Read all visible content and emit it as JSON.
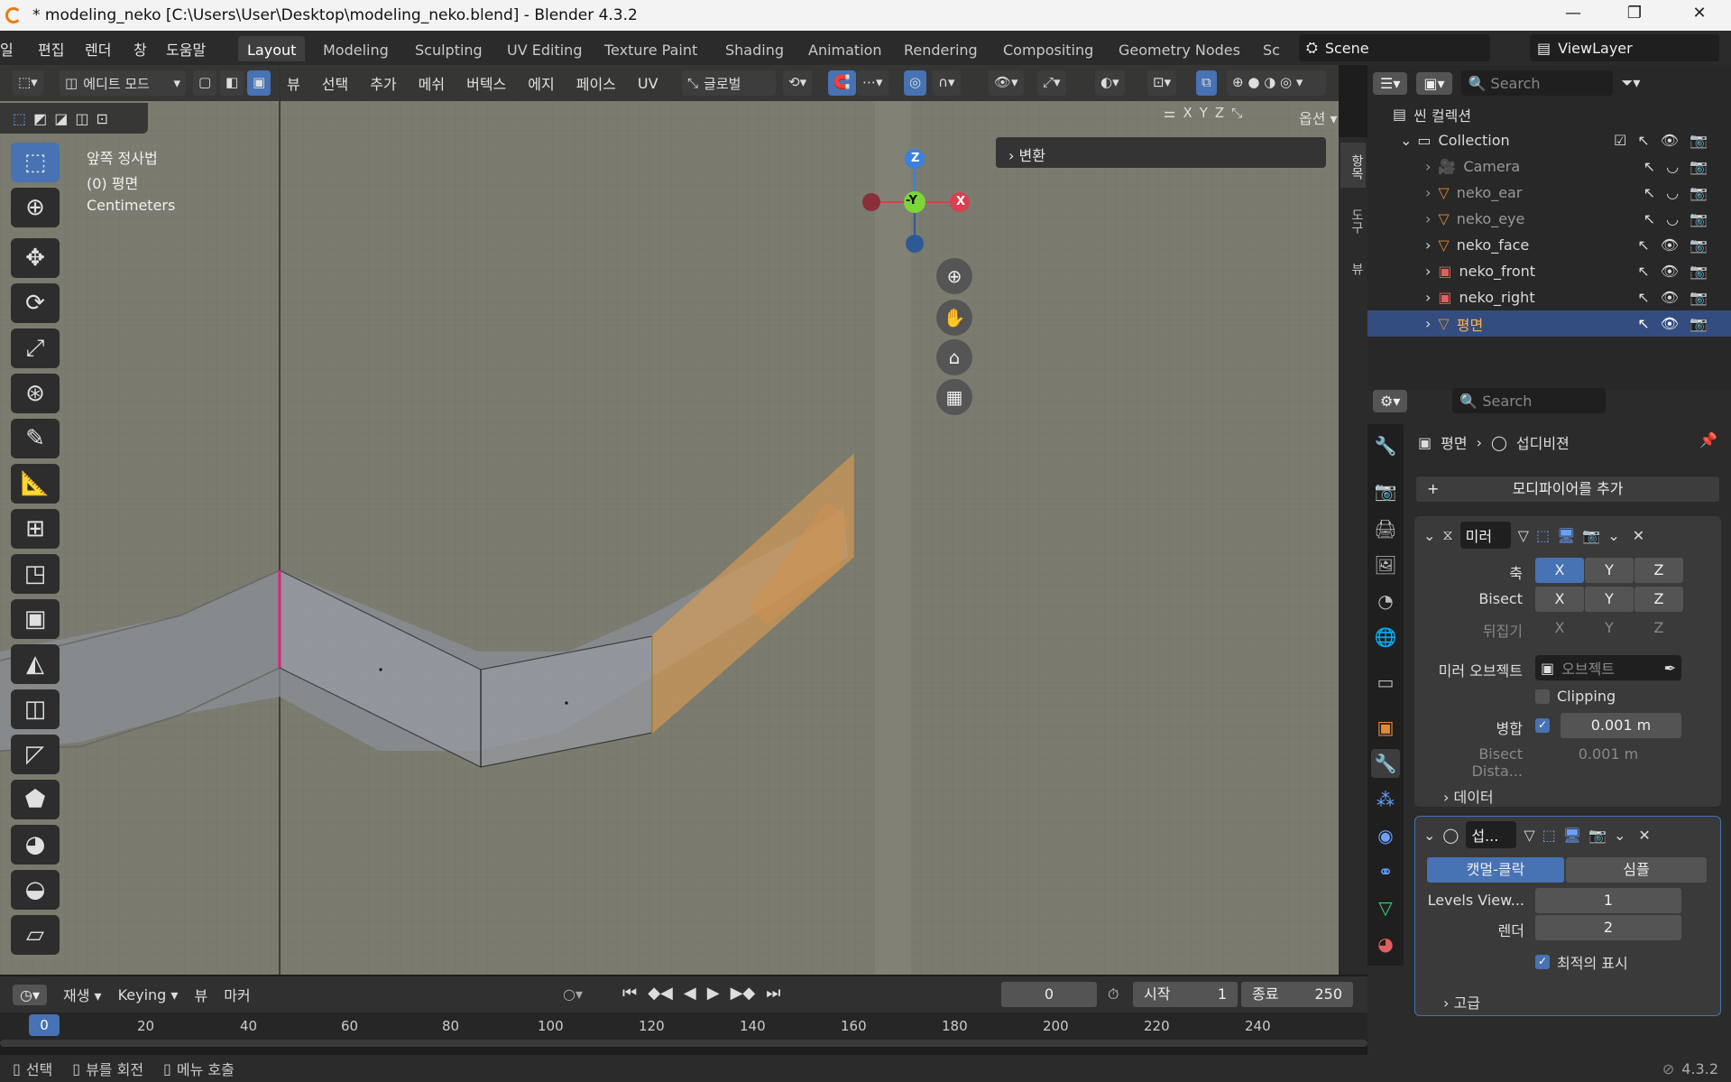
{
  "titlebar": {
    "title": "* modeling_neko [C:\\Users\\User\\Desktop\\modeling_neko.blend] - Blender 4.3.2",
    "minimize": "—",
    "restore": "❐",
    "close": "✕"
  },
  "menu": {
    "file": "일",
    "edit": "편집",
    "render": "렌더",
    "window": "창",
    "help": "도움말"
  },
  "workspaces": [
    "Layout",
    "Modeling",
    "Sculpting",
    "UV Editing",
    "Texture Paint",
    "Shading",
    "Animation",
    "Rendering",
    "Compositing",
    "Geometry Nodes",
    "Sc"
  ],
  "scene": {
    "name": "Scene",
    "viewlayer": "ViewLayer"
  },
  "vheader": {
    "mode": "에디트 모드",
    "menus": [
      "뷰",
      "선택",
      "추가",
      "메쉬",
      "버텍스",
      "에지",
      "페이스",
      "UV"
    ],
    "orientation": "글로벌",
    "options": "옵션",
    "axes": [
      "X",
      "Y",
      "Z"
    ]
  },
  "viewport": {
    "view_name": "앞쪽 정사법",
    "object_label": "(0) 평면",
    "units": "Centimeters",
    "panel_title": "변환",
    "side_tabs": [
      "항목",
      "도구",
      "뷰"
    ],
    "gizmo": {
      "z": "Z",
      "y": "-Y",
      "x": "X"
    }
  },
  "outliner": {
    "search_placeholder": "Search",
    "root": "씬 컬렉션",
    "collection": "Collection",
    "items": [
      {
        "name": "Camera"
      },
      {
        "name": "neko_ear"
      },
      {
        "name": "neko_eye"
      },
      {
        "name": "neko_face"
      },
      {
        "name": "neko_front"
      },
      {
        "name": "neko_right"
      },
      {
        "name": "평면"
      }
    ]
  },
  "properties": {
    "search_placeholder": "Search",
    "breadcrumb_object": "평면",
    "breadcrumb_modifier": "섭디비젼",
    "add_modifier": "모디파이어를 추가",
    "mirror": {
      "name": "미러",
      "axis_label": "축",
      "bisect_label": "Bisect",
      "flip_label": "뒤집기",
      "xyz": [
        "X",
        "Y",
        "Z"
      ],
      "mirror_object_label": "미러 오브젝트",
      "mirror_object_placeholder": "오브젝트",
      "clipping": "Clipping",
      "merge_label": "병합",
      "merge_value": "0.001 m",
      "bisect_distance_label": "Bisect Dista...",
      "bisect_distance_value": "0.001 m",
      "data_label": "데이터"
    },
    "subsurf": {
      "name": "섭...",
      "catmull": "캣멀-클락",
      "simple": "심플",
      "levels_label": "Levels View...",
      "levels_value": "1",
      "render_label": "렌더",
      "render_value": "2",
      "optimal_label": "최적의 표시",
      "advanced": "고급"
    }
  },
  "timeline": {
    "playback": "재생",
    "keying": "Keying",
    "view": "뷰",
    "marker": "마커",
    "current_frame": "0",
    "start_label": "시작",
    "start_value": "1",
    "end_label": "종료",
    "end_value": "250",
    "ticks": [
      "0",
      "20",
      "40",
      "60",
      "80",
      "100",
      "120",
      "140",
      "160",
      "180",
      "200",
      "220",
      "240"
    ]
  },
  "status": {
    "select": "선택",
    "rotate": "뷰를 회전",
    "menu": "메뉴 호출",
    "version": "4.3.2"
  }
}
